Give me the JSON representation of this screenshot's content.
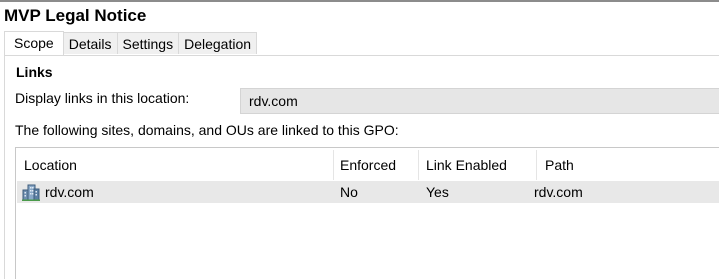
{
  "header": {
    "title": "MVP Legal Notice"
  },
  "tabs": [
    {
      "label": "Scope",
      "active": true
    },
    {
      "label": "Details",
      "active": false
    },
    {
      "label": "Settings",
      "active": false
    },
    {
      "label": "Delegation",
      "active": false
    }
  ],
  "scope": {
    "section_heading": "Links",
    "display_label": "Display links in this location:",
    "display_value": "rdv.com",
    "linked_caption": "The following sites, domains, and OUs are linked to this GPO:",
    "table": {
      "columns": [
        "Location",
        "Enforced",
        "Link Enabled",
        "Path"
      ],
      "rows": [
        {
          "icon": "domain-icon",
          "location": "rdv.com",
          "enforced": "No",
          "link_enabled": "Yes",
          "path": "rdv.com"
        }
      ]
    }
  },
  "colors": {
    "selected_row": "#e8e8e8",
    "field_background": "#e6e6e6",
    "tab_background": "#f0f0f0"
  }
}
